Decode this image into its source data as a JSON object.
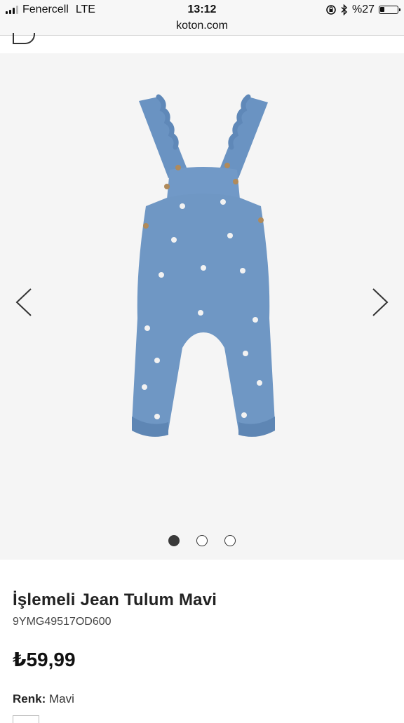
{
  "status_bar": {
    "carrier": "Fenercell",
    "network": "LTE",
    "time": "13:12",
    "battery": "%27",
    "battery_level": 0.27,
    "signal_bars_on": 3,
    "icons": [
      "signal-icon",
      "orientation-lock-icon",
      "bluetooth-icon",
      "battery-icon"
    ]
  },
  "browser": {
    "url": "koton.com"
  },
  "gallery": {
    "slide_count": 3,
    "active_index": 0,
    "prev_icon": "chevron-left-icon",
    "next_icon": "chevron-right-icon"
  },
  "product": {
    "name": "İşlemeli Jean Tulum Mavi",
    "sku": "9YMG49517OD600",
    "price": "₺59,99",
    "color_label": "Renk:",
    "color_value": "Mavi"
  },
  "colors": {
    "denim": "#6f97c4",
    "denim_dark": "#4f78a8",
    "gallery_bg": "#f5f5f5"
  }
}
